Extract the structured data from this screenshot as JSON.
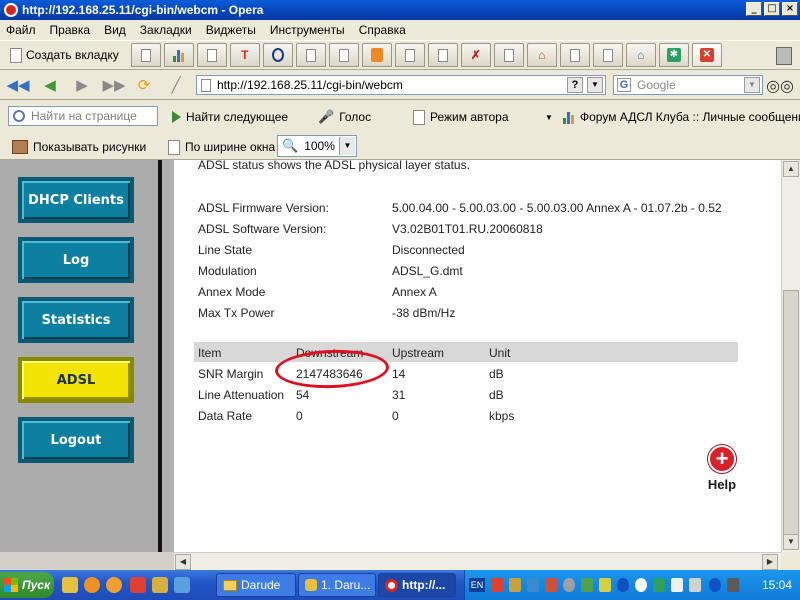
{
  "window": {
    "title": "http://192.168.25.11/cgi-bin/webcm - Opera",
    "controls": [
      "_",
      "□",
      "×"
    ]
  },
  "menu": [
    "Файл",
    "Правка",
    "Вид",
    "Закладки",
    "Виджеты",
    "Инструменты",
    "Справка"
  ],
  "tabs": {
    "new_tab_label": "Создать вкладку"
  },
  "address": {
    "url": "http://192.168.25.11/cgi-bin/webcm",
    "search_placeholder": "Google"
  },
  "panel1": {
    "find_placeholder": "Найти на странице",
    "find_next": "Найти следующее",
    "voice": "Голос",
    "author_mode": "Режим автора",
    "bookmark": "Форум АДСЛ Клуба :: Личные сообщения"
  },
  "panel2": {
    "show_images": "Показывать рисунки",
    "fit_width": "По ширине окна",
    "zoom": "100%"
  },
  "sidebar": {
    "buttons": [
      {
        "label": "DHCP Clients",
        "active": false
      },
      {
        "label": "Log",
        "active": false
      },
      {
        "label": "Statistics",
        "active": false
      },
      {
        "label": "ADSL",
        "active": true
      },
      {
        "label": "Logout",
        "active": false
      }
    ]
  },
  "adsl": {
    "intro": "ADSL status shows the ADSL physical layer status.",
    "info": [
      {
        "key": "ADSL Firmware Version:",
        "value": "5.00.04.00 - 5.00.03.00 - 5.00.03.00 Annex A - 01.07.2b - 0.52"
      },
      {
        "key": "ADSL Software Version:",
        "value": "V3.02B01T01.RU.20060818"
      },
      {
        "key": "Line State",
        "value": "Disconnected"
      },
      {
        "key": "Modulation",
        "value": "ADSL_G.dmt"
      },
      {
        "key": "Annex Mode",
        "value": "Annex A"
      },
      {
        "key": "Max Tx Power",
        "value": "-38 dBm/Hz"
      }
    ],
    "table": {
      "headers": [
        "Item",
        "Downstream",
        "Upstream",
        "Unit"
      ],
      "rows": [
        [
          "SNR Margin",
          "2147483646",
          "14",
          "dB"
        ],
        [
          "Line Attenuation",
          "54",
          "31",
          "dB"
        ],
        [
          "Data Rate",
          "0",
          "0",
          "kbps"
        ]
      ]
    },
    "help_label": "Help",
    "highlight_color": "#e01020"
  },
  "taskbar": {
    "start_label": "Пуск",
    "windows": [
      {
        "label": "Darude",
        "icon": "folder-icon",
        "active": false
      },
      {
        "label": "1. Daru...",
        "icon": "music-icon",
        "active": false
      },
      {
        "label": "http://...",
        "icon": "opera-icon",
        "active": true
      }
    ],
    "lang": "EN",
    "clock": "15:04"
  },
  "colors": {
    "nav_button": "#0d7fa0",
    "nav_button_active": "#f2e400",
    "taskbar": "#2457c8"
  }
}
